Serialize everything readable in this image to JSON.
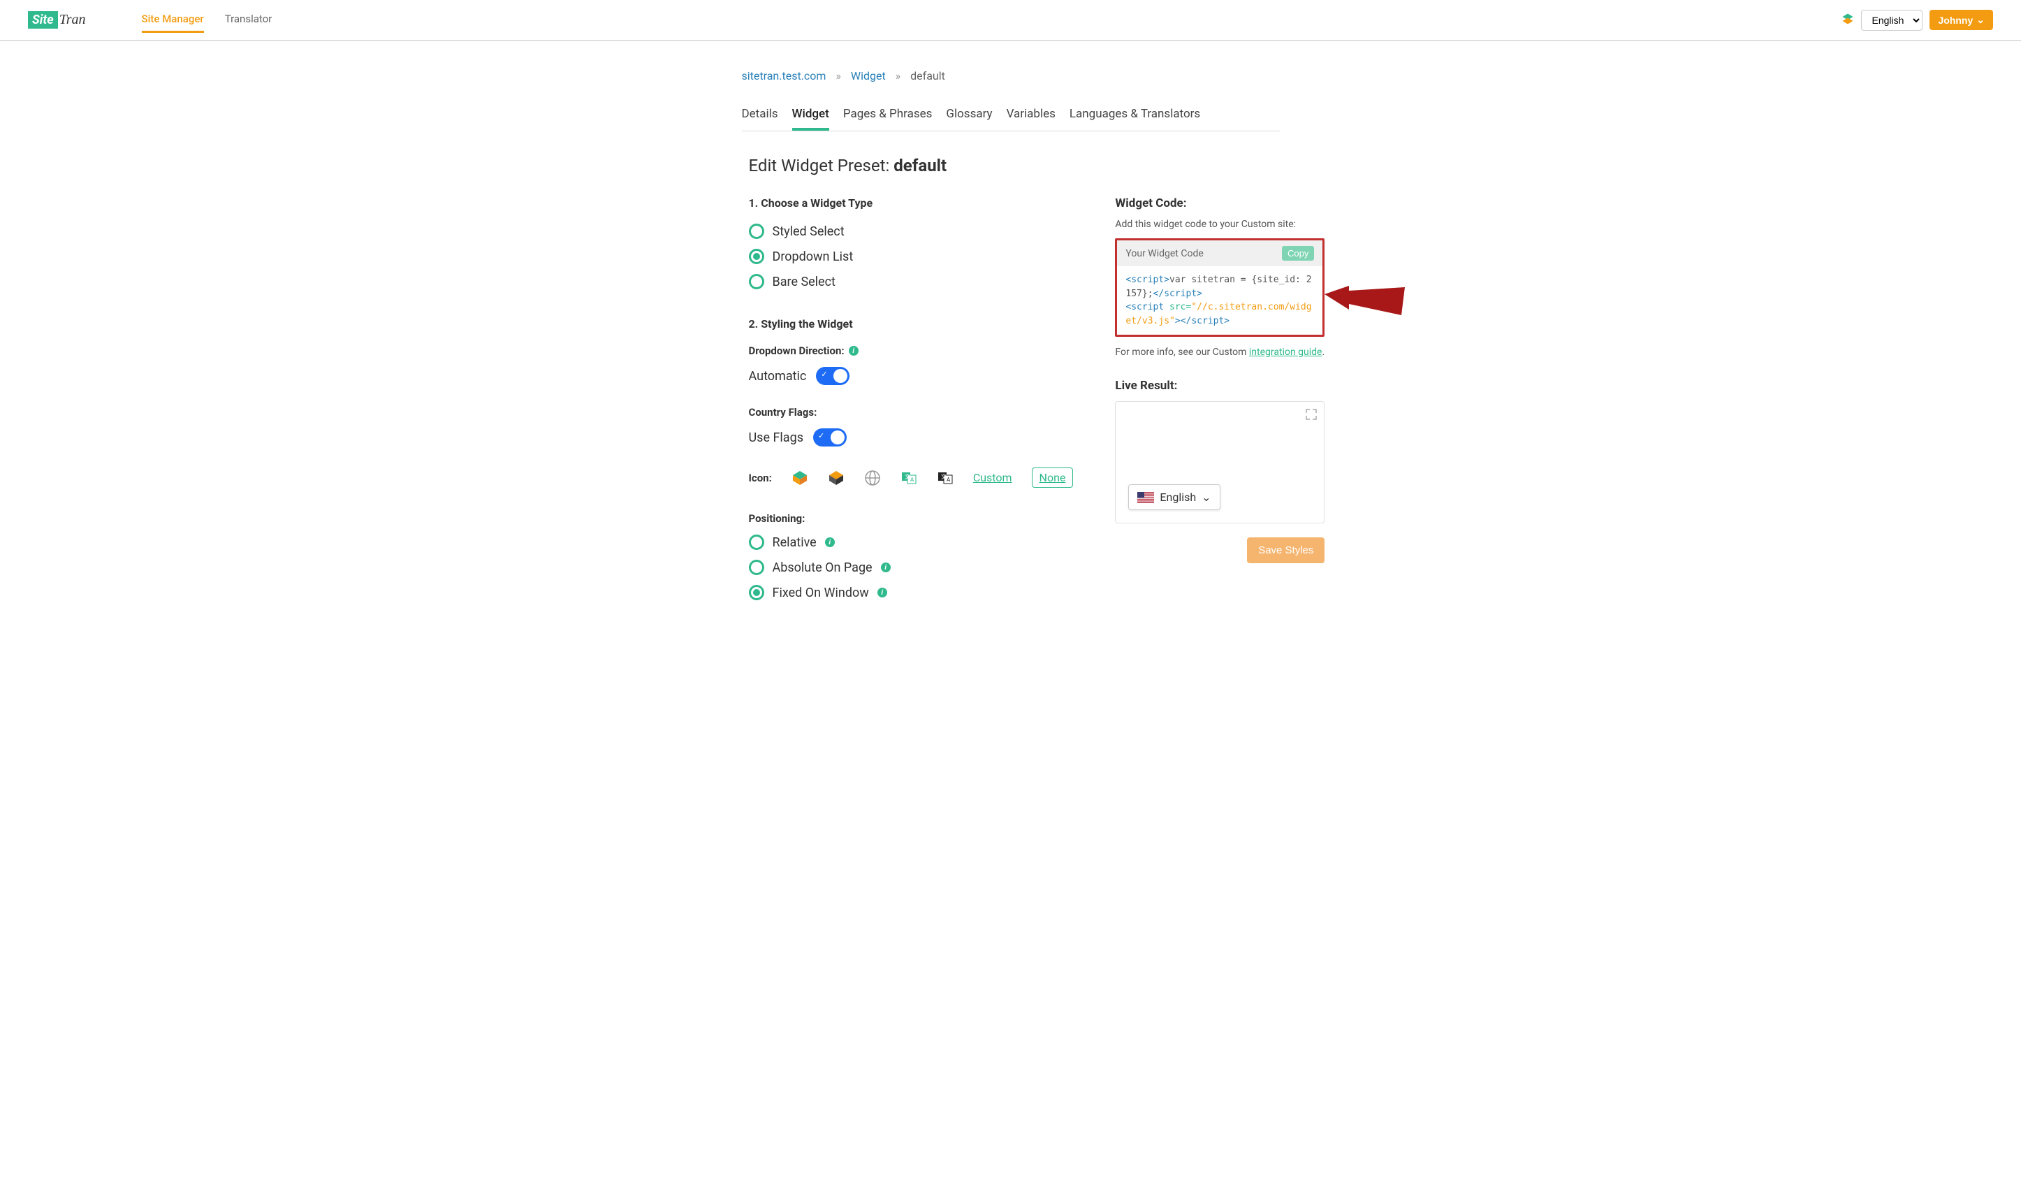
{
  "header": {
    "logo_box": "Site",
    "logo_text": "Tran",
    "nav": [
      {
        "label": "Site Manager",
        "active": true
      },
      {
        "label": "Translator",
        "active": false
      }
    ],
    "lang": "English",
    "user": "Johnny"
  },
  "breadcrumb": {
    "site": "sitetran.test.com",
    "section": "Widget",
    "current": "default"
  },
  "tabs": [
    {
      "label": "Details",
      "active": false
    },
    {
      "label": "Widget",
      "active": true
    },
    {
      "label": "Pages & Phrases",
      "active": false
    },
    {
      "label": "Glossary",
      "active": false
    },
    {
      "label": "Variables",
      "active": false
    },
    {
      "label": "Languages & Translators",
      "active": false
    }
  ],
  "page_title_prefix": "Edit Widget Preset: ",
  "page_title_value": "default",
  "section1": {
    "title": "1. Choose a Widget Type",
    "options": [
      "Styled Select",
      "Dropdown List",
      "Bare Select"
    ],
    "selected": 1
  },
  "section2": {
    "title": "2. Styling the Widget",
    "direction_label": "Dropdown Direction:",
    "direction_toggle": "Automatic",
    "flags_label": "Country Flags:",
    "flags_toggle": "Use Flags",
    "icon_label": "Icon:",
    "custom_link": "Custom",
    "none_link": "None",
    "positioning_label": "Positioning:",
    "positioning_options": [
      "Relative",
      "Absolute On Page",
      "Fixed On Window"
    ],
    "positioning_selected": 2
  },
  "widget_code": {
    "header": "Widget Code:",
    "sub": "Add this widget code to your Custom site:",
    "box_label": "Your Widget Code",
    "copy": "Copy",
    "line1_open": "<script>",
    "line1_body": "var sitetran = {site_id: 2157};",
    "line1_close": "</script>",
    "line2_open": "<script ",
    "line2_attr": "src=",
    "line2_val": "\"//c.sitetran.com/widget/v3.js\"",
    "line2_mid": ">",
    "line2_close": "</script>",
    "more_info_prefix": "For more info, see our Custom ",
    "more_info_link": "integration guide",
    "more_info_suffix": "."
  },
  "live": {
    "header": "Live Result:",
    "widget_lang": "English"
  },
  "save_button": "Save Styles"
}
